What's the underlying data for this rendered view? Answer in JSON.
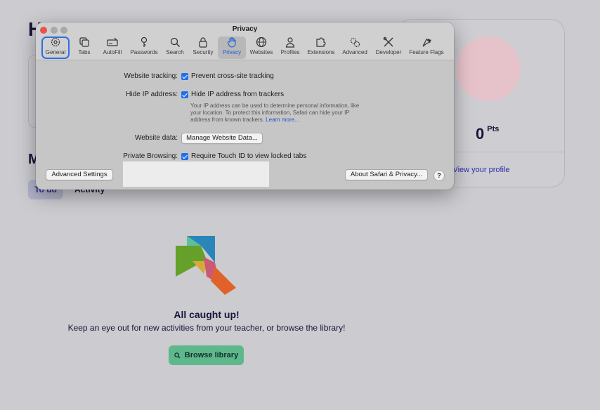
{
  "background": {
    "heading_partial": "H",
    "section_partial": "M",
    "tabs": [
      "To do",
      "Activity"
    ],
    "profile": {
      "points_value": "0",
      "points_unit": "Pts",
      "link": "View your profile"
    },
    "empty_state": {
      "title": "All caught up!",
      "subtitle": "Keep an eye out for new activities from your teacher, or browse the library!",
      "button": "Browse library"
    }
  },
  "window": {
    "title": "Privacy",
    "tabs": [
      {
        "label": "General",
        "icon": "gear-icon"
      },
      {
        "label": "Tabs",
        "icon": "tabs-icon"
      },
      {
        "label": "AutoFill",
        "icon": "autofill-icon"
      },
      {
        "label": "Passwords",
        "icon": "key-icon"
      },
      {
        "label": "Search",
        "icon": "search-icon"
      },
      {
        "label": "Security",
        "icon": "lock-icon"
      },
      {
        "label": "Privacy",
        "icon": "hand-icon"
      },
      {
        "label": "Websites",
        "icon": "globe-icon"
      },
      {
        "label": "Profiles",
        "icon": "person-icon"
      },
      {
        "label": "Extensions",
        "icon": "puzzle-icon"
      },
      {
        "label": "Advanced",
        "icon": "gears-icon"
      },
      {
        "label": "Developer",
        "icon": "tools-icon"
      },
      {
        "label": "Feature Flags",
        "icon": "flags-icon"
      }
    ],
    "active_tab": "Privacy",
    "focused_tab": "General",
    "settings": {
      "tracking_label": "Website tracking:",
      "tracking_option": "Prevent cross-site tracking",
      "ip_label": "Hide IP address:",
      "ip_option": "Hide IP address from trackers",
      "ip_description": "Your IP address can be used to determine personal information, like your location. To protect this information, Safari can hide your IP address from known trackers.",
      "ip_learn_more": "Learn more...",
      "website_data_label": "Website data:",
      "website_data_button": "Manage Website Data...",
      "private_label": "Private Browsing:",
      "private_option": "Require Touch ID to view locked tabs"
    },
    "footer": {
      "advanced_button": "Advanced Settings",
      "about_button": "About Safari & Privacy...",
      "help": "?"
    }
  },
  "colors": {
    "accent": "#1f6feb",
    "close": "#e9534c",
    "browse_button": "#5fb88c",
    "link": "#2e2ea8"
  }
}
